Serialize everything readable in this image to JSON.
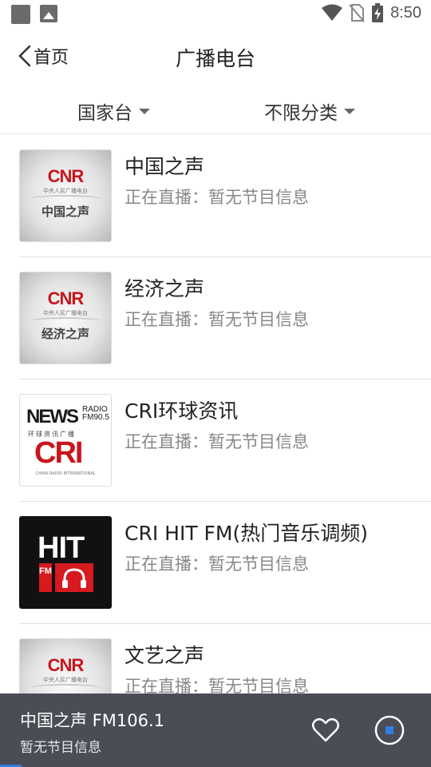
{
  "status_bar": {
    "time": "8:50",
    "icons": [
      "app-notification-icon",
      "image-notification-icon",
      "wifi-icon",
      "no-sim-icon",
      "battery-charging-icon"
    ]
  },
  "header": {
    "back_label": "首页",
    "title": "广播电台"
  },
  "filters": {
    "country": "国家台",
    "category": "不限分类"
  },
  "stations": [
    {
      "title": "中国之声",
      "subtitle": "正在直播：暂无节目信息",
      "logo": {
        "brand": "CNR",
        "small": "中央人民广播电台",
        "name": "中国之声"
      }
    },
    {
      "title": "经济之声",
      "subtitle": "正在直播：暂无节目信息",
      "logo": {
        "brand": "CNR",
        "small": "中央人民广播电台",
        "name": "经济之声"
      }
    },
    {
      "title": "CRI环球资讯",
      "subtitle": "正在直播：暂无节目信息",
      "logo": {
        "news": "NEWS",
        "radio": "RADIO",
        "freq": "FM90.5",
        "sub": "环球资讯广播",
        "big": "CRI",
        "tiny": "CHINA RADIO INTERNATIONAL"
      }
    },
    {
      "title": "CRI HIT FM(热门音乐调频)",
      "subtitle": "正在直播：暂无节目信息",
      "logo": {
        "text": "HIT",
        "fm": "FM"
      }
    },
    {
      "title": "文艺之声",
      "subtitle": "正在直播：暂无节目信息",
      "logo": {
        "brand": "CNR",
        "small": "中央人民广播电台",
        "name": ""
      }
    }
  ],
  "player": {
    "title": "中国之声 FM106.1",
    "subtitle": "暂无节目信息",
    "progress_percent": 5,
    "accent": "#2f7fe0",
    "background": "#4a4d55"
  }
}
